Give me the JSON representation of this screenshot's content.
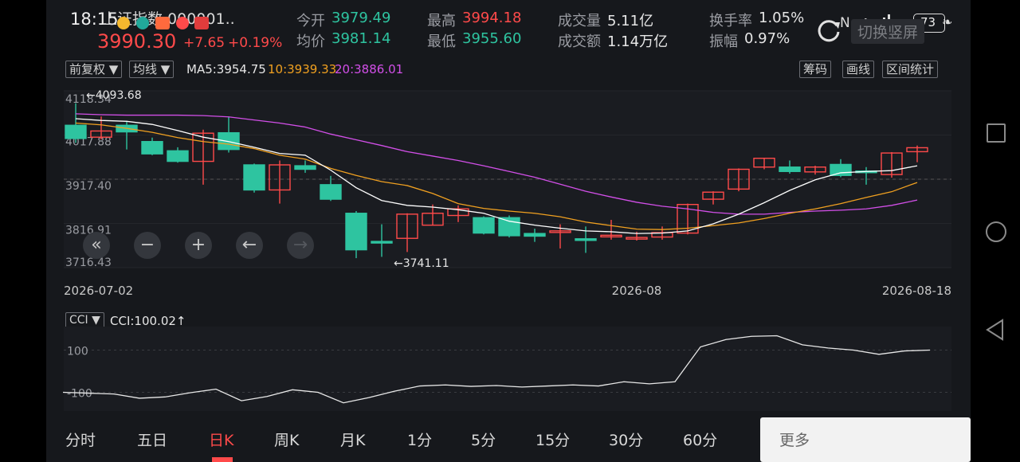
{
  "status_bar": {
    "time": "18:15",
    "battery": "73"
  },
  "header": {
    "index_name": "上证指数 000001..",
    "price": "3990.30",
    "change": "+7.65",
    "change_pct": "+0.19%",
    "stats": [
      {
        "label": "今开",
        "value": "3979.49",
        "color": "#2ec4a0"
      },
      {
        "label": "均价",
        "value": "3981.14",
        "color": "#2ec4a0"
      },
      {
        "label": "最高",
        "value": "3994.18",
        "color": "#ff4a4a"
      },
      {
        "label": "最低",
        "value": "3955.60",
        "color": "#2ec4a0"
      },
      {
        "label": "成交量",
        "value": "5.11亿",
        "color": "#e6e6e6"
      },
      {
        "label": "成交额",
        "value": "1.14万亿",
        "color": "#e6e6e6"
      },
      {
        "label": "换手率",
        "value": "1.05%",
        "color": "#e6e6e6"
      },
      {
        "label": "振幅",
        "value": "0.97%",
        "color": "#e6e6e6"
      }
    ],
    "switch_label": "切换竖屏"
  },
  "toolbar": {
    "adjust": "前复权 ▼",
    "ma_select": "均线 ▼",
    "ma5": "MA5:3954.75",
    "ma10": "10:3939.33",
    "ma20": "20:3886.01",
    "chips": "筹码",
    "draw": "画线",
    "range_stats": "区间统计"
  },
  "colors": {
    "up": "#ff4a4a",
    "down": "#2ec4a0",
    "ma5": "#ffffff",
    "ma10": "#f0a020",
    "ma20": "#d24fe8",
    "bg": "#16181c"
  },
  "chart_data": [
    {
      "type": "candlestick",
      "ylim": [
        3716.43,
        4118.34
      ],
      "yticks": [
        "4118.34",
        "4017.88",
        "3917.40",
        "3816.91",
        "3716.43"
      ],
      "xtick_labels": [
        "2026-07-02",
        "2026-08",
        "2026-08-18"
      ],
      "annotations": {
        "high": "←4093.68",
        "low": "←3741.11"
      },
      "candles": [
        {
          "o": 4040,
          "c": 4010,
          "h": 4090,
          "l": 4000
        },
        {
          "o": 4013,
          "c": 4027,
          "h": 4060,
          "l": 4008
        },
        {
          "o": 4040,
          "c": 4025,
          "h": 4050,
          "l": 3985
        },
        {
          "o": 4003,
          "c": 3975,
          "h": 4012,
          "l": 3972
        },
        {
          "o": 3982,
          "c": 3958,
          "h": 3990,
          "l": 3955
        },
        {
          "o": 3958,
          "c": 4022,
          "h": 4030,
          "l": 3905
        },
        {
          "o": 4023,
          "c": 3985,
          "h": 4060,
          "l": 3978
        },
        {
          "o": 3950,
          "c": 3893,
          "h": 3953,
          "l": 3887
        },
        {
          "o": 3893,
          "c": 3950,
          "h": 3960,
          "l": 3862
        },
        {
          "o": 3948,
          "c": 3940,
          "h": 3960,
          "l": 3932
        },
        {
          "o": 3905,
          "c": 3872,
          "h": 3925,
          "l": 3868
        },
        {
          "o": 3840,
          "c": 3757,
          "h": 3845,
          "l": 3738
        },
        {
          "o": 3776,
          "c": 3774,
          "h": 3815,
          "l": 3741
        },
        {
          "o": 3783,
          "c": 3838,
          "h": 3840,
          "l": 3752
        },
        {
          "o": 3813,
          "c": 3840,
          "h": 3860,
          "l": 3812
        },
        {
          "o": 3835,
          "c": 3850,
          "h": 3858,
          "l": 3820
        },
        {
          "o": 3830,
          "c": 3795,
          "h": 3833,
          "l": 3792
        },
        {
          "o": 3830,
          "c": 3789,
          "h": 3835,
          "l": 3785
        },
        {
          "o": 3794,
          "c": 3788,
          "h": 3805,
          "l": 3775
        },
        {
          "o": 3798,
          "c": 3800,
          "h": 3815,
          "l": 3760
        },
        {
          "o": 3782,
          "c": 3780,
          "h": 3810,
          "l": 3750
        },
        {
          "o": 3790,
          "c": 3790,
          "h": 3825,
          "l": 3780
        },
        {
          "o": 3782,
          "c": 3785,
          "h": 3798,
          "l": 3778
        },
        {
          "o": 3786,
          "c": 3796,
          "h": 3810,
          "l": 3780
        },
        {
          "o": 3795,
          "c": 3860,
          "h": 3862,
          "l": 3792
        },
        {
          "o": 3872,
          "c": 3888,
          "h": 3890,
          "l": 3860
        },
        {
          "o": 3895,
          "c": 3940,
          "h": 3942,
          "l": 3890
        },
        {
          "o": 3945,
          "c": 3965,
          "h": 3966,
          "l": 3940
        },
        {
          "o": 3945,
          "c": 3935,
          "h": 3960,
          "l": 3930
        },
        {
          "o": 3934,
          "c": 3945,
          "h": 3948,
          "l": 3928
        },
        {
          "o": 3951,
          "c": 3926,
          "h": 3963,
          "l": 3922
        },
        {
          "o": 3936,
          "c": 3933,
          "h": 3945,
          "l": 3905
        },
        {
          "o": 3928,
          "c": 3977,
          "h": 3979,
          "l": 3921
        },
        {
          "o": 3980,
          "c": 3989,
          "h": 3994,
          "l": 3956
        }
      ],
      "ma5": [
        4055,
        4051,
        4049,
        4042,
        4028,
        4013,
        4003,
        3990,
        3976,
        3972,
        3938,
        3898,
        3869,
        3858,
        3854,
        3848,
        3840,
        3822,
        3813,
        3806,
        3800,
        3798,
        3794,
        3795,
        3800,
        3816,
        3838,
        3864,
        3892,
        3916,
        3932,
        3935,
        3937,
        3948
      ],
      "ma10": [
        4045,
        4041,
        4033,
        4024,
        4012,
        4003,
        3997,
        3987,
        3972,
        3963,
        3942,
        3926,
        3912,
        3903,
        3885,
        3862,
        3851,
        3845,
        3840,
        3832,
        3820,
        3812,
        3804,
        3803,
        3806,
        3812,
        3818,
        3828,
        3840,
        3850,
        3862,
        3876,
        3889,
        3910
      ],
      "ma20": [
        4066,
        4064,
        4063,
        4063,
        4063,
        4062,
        4059,
        4052,
        4045,
        4036,
        4020,
        4007,
        3994,
        3980,
        3970,
        3960,
        3948,
        3935,
        3922,
        3906,
        3890,
        3877,
        3865,
        3856,
        3850,
        3842,
        3838,
        3838,
        3842,
        3845,
        3847,
        3850,
        3858,
        3870
      ]
    },
    {
      "type": "line",
      "indicator": "CCI",
      "select_label": "CCI ▼",
      "value_label": "CCI:100.02↑",
      "yticks": [
        "100",
        "-100"
      ],
      "ylim": [
        -200,
        200
      ],
      "values": [
        -100,
        -104,
        -108,
        -128,
        -122,
        -102,
        -85,
        -140,
        -120,
        -88,
        -100,
        -150,
        -125,
        -95,
        -70,
        -65,
        -72,
        -68,
        -75,
        -70,
        -65,
        -70,
        -50,
        -60,
        -50,
        115,
        150,
        165,
        168,
        125,
        110,
        100,
        80,
        96,
        100
      ]
    }
  ],
  "zoom_controls": [
    "«",
    "−",
    "+",
    "←",
    "→"
  ],
  "period_tabs": [
    "分时",
    "五日",
    "日K",
    "周K",
    "月K",
    "1分",
    "5分",
    "15分",
    "30分",
    "60分"
  ],
  "active_tab": "日K",
  "bottom_right": "更多"
}
